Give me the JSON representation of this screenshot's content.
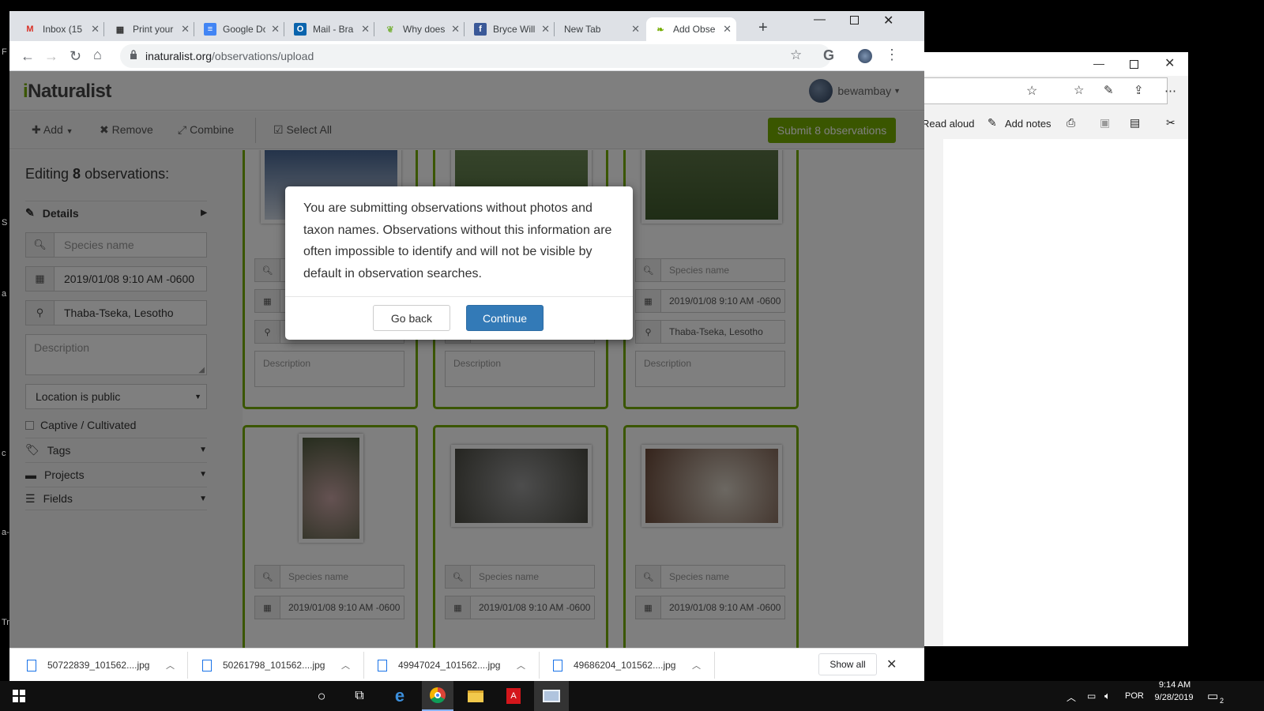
{
  "chrome": {
    "tabs": [
      {
        "label": "Inbox (15",
        "icon": "gmail-icon"
      },
      {
        "label": "Print your",
        "icon": "print-icon"
      },
      {
        "label": "Google Do",
        "icon": "docs-icon"
      },
      {
        "label": "Mail - Bra",
        "icon": "outlook-icon"
      },
      {
        "label": "Why does",
        "icon": "leaf-icon"
      },
      {
        "label": "Bryce Will",
        "icon": "facebook-icon"
      },
      {
        "label": "New Tab",
        "icon": ""
      },
      {
        "label": "Add Obse",
        "icon": "inat-leaf-icon"
      }
    ],
    "url_domain": "inaturalist.org",
    "url_path": "/observations/upload"
  },
  "inat": {
    "logo": "Naturalist",
    "logo_i": "i",
    "username": "bewambay",
    "toolbar": {
      "add": "Add",
      "remove": "Remove",
      "combine": "Combine",
      "select_all": "Select All",
      "submit": "Submit 8 observations"
    },
    "sidebar": {
      "title_prefix": "Editing ",
      "title_count": "8",
      "title_suffix": " observations:",
      "details": "Details",
      "species_placeholder": "Species name",
      "date": "2019/01/08 9:10 AM -0600",
      "location": "Thaba-Tseka, Lesotho",
      "description_placeholder": "Description",
      "location_privacy": "Location is public",
      "captive": "Captive / Cultivated",
      "tags": "Tags",
      "projects": "Projects",
      "fields": "Fields"
    },
    "cards": {
      "species_placeholder": "Species name",
      "date": "2019/01/08 9:10 AM -0600",
      "location": "Thaba-Tseka, Lesotho",
      "description_placeholder": "Description"
    },
    "modal": {
      "message": "You are submitting observations without photos and taxon names. Observations without this information are often impossible to identify and will not be visible by default in observation searches.",
      "go_back": "Go back",
      "continue": "Continue"
    }
  },
  "downloads": {
    "items": [
      "50722839_101562....jpg",
      "50261798_101562....jpg",
      "49947024_101562....jpg",
      "49686204_101562....jpg"
    ],
    "show_all": "Show all"
  },
  "edge": {
    "read_aloud": "Read aloud",
    "add_notes": "Add notes"
  },
  "taskbar": {
    "language": "POR",
    "time": "9:14 AM",
    "date": "9/28/2019",
    "notifications": "2"
  },
  "colors": {
    "inat_green": "#74ac00",
    "primary_blue": "#337ab7"
  }
}
